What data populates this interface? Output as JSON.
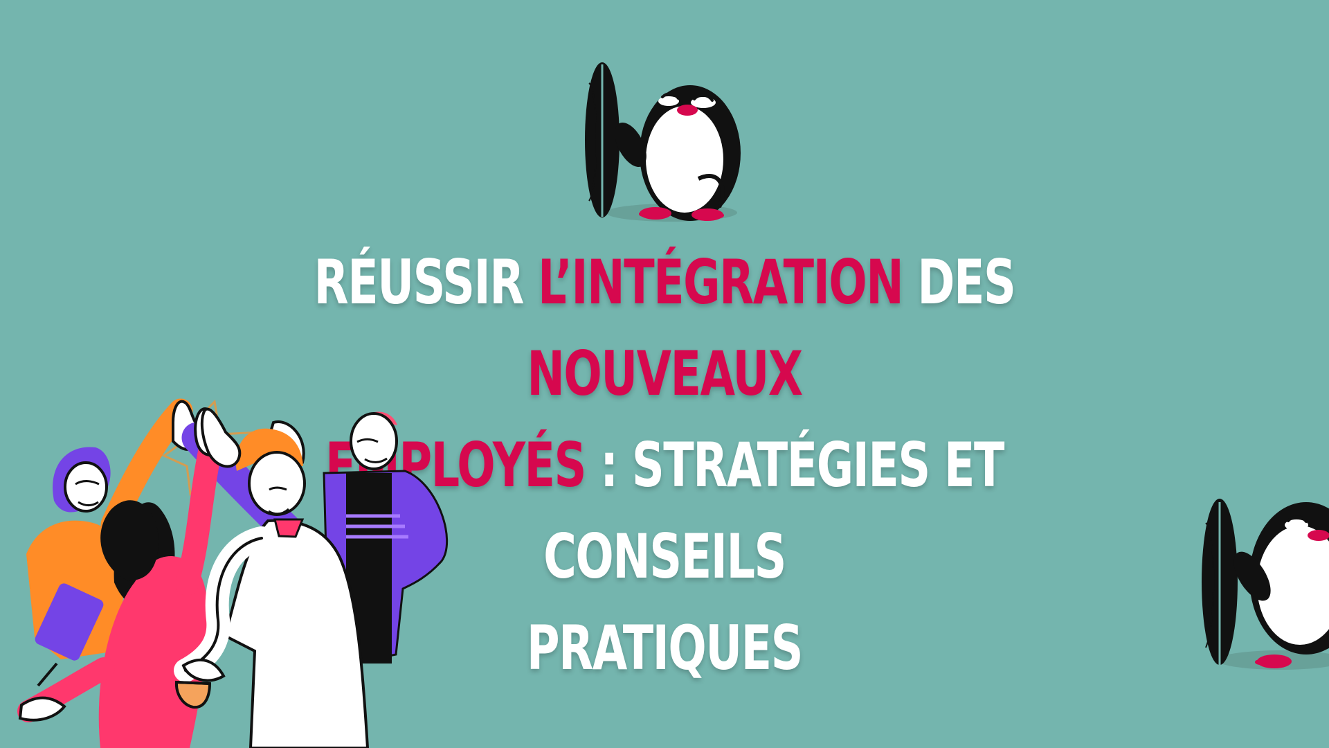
{
  "headline": {
    "part1": "RÉUSSIR ",
    "part2": "L’INTÉGRATION",
    "part3": " DES ",
    "part4": "NOUVEAUX",
    "part5": "EMPLOYÉS",
    "part6": " : STRATÉGIES ET CONSEILS",
    "part7": "PRATIQUES"
  },
  "colors": {
    "background": "#74b5ae",
    "accent": "#d6084e",
    "text": "#ffffff"
  },
  "illustrations": {
    "top_mascot": "penguin-with-surfboard-icon",
    "right_mascot": "penguin-with-surfboard-icon",
    "team": "team-high-five-illustration"
  }
}
